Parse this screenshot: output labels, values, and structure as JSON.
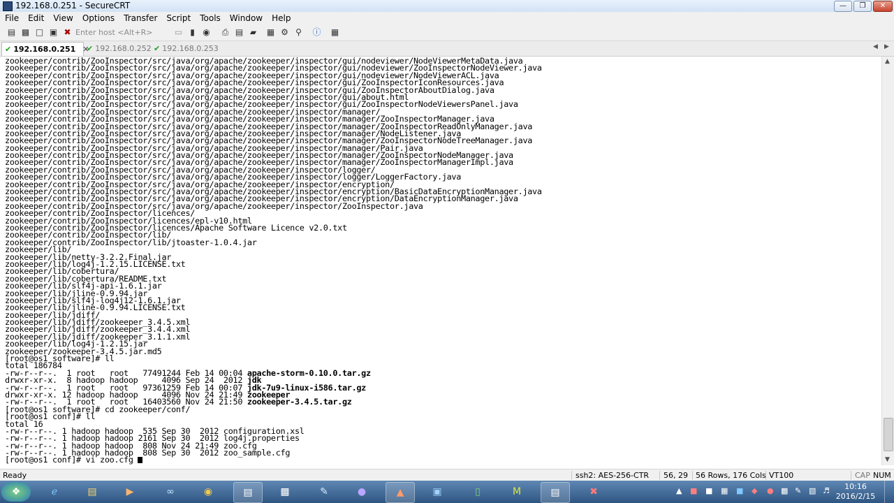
{
  "window": {
    "title": "192.168.0.251 - SecureCRT"
  },
  "menu": [
    "File",
    "Edit",
    "View",
    "Options",
    "Transfer",
    "Script",
    "Tools",
    "Window",
    "Help"
  ],
  "toolbar": {
    "host_placeholder": "Enter host <Alt+R>"
  },
  "tabs": [
    {
      "label": "192.168.0.251",
      "active": true
    },
    {
      "label": "192.168.0.252",
      "active": false
    },
    {
      "label": "192.168.0.253",
      "active": false
    }
  ],
  "terminal": {
    "lines": [
      "zookeeper/contrib/ZooInspector/src/java/org/apache/zookeeper/inspector/gui/nodeviewer/NodeViewerMetaData.java",
      "zookeeper/contrib/ZooInspector/src/java/org/apache/zookeeper/inspector/gui/nodeviewer/ZooInspectorNodeViewer.java",
      "zookeeper/contrib/ZooInspector/src/java/org/apache/zookeeper/inspector/gui/nodeviewer/NodeViewerACL.java",
      "zookeeper/contrib/ZooInspector/src/java/org/apache/zookeeper/inspector/gui/ZooInspectorIconResources.java",
      "zookeeper/contrib/ZooInspector/src/java/org/apache/zookeeper/inspector/gui/ZooInspectorAboutDialog.java",
      "zookeeper/contrib/ZooInspector/src/java/org/apache/zookeeper/inspector/gui/about.html",
      "zookeeper/contrib/ZooInspector/src/java/org/apache/zookeeper/inspector/gui/ZooInspectorNodeViewersPanel.java",
      "zookeeper/contrib/ZooInspector/src/java/org/apache/zookeeper/inspector/manager/",
      "zookeeper/contrib/ZooInspector/src/java/org/apache/zookeeper/inspector/manager/ZooInspectorManager.java",
      "zookeeper/contrib/ZooInspector/src/java/org/apache/zookeeper/inspector/manager/ZooInspectorReadOnlyManager.java",
      "zookeeper/contrib/ZooInspector/src/java/org/apache/zookeeper/inspector/manager/NodeListener.java",
      "zookeeper/contrib/ZooInspector/src/java/org/apache/zookeeper/inspector/manager/ZooInspectorNodeTreeManager.java",
      "zookeeper/contrib/ZooInspector/src/java/org/apache/zookeeper/inspector/manager/Pair.java",
      "zookeeper/contrib/ZooInspector/src/java/org/apache/zookeeper/inspector/manager/ZooInspectorNodeManager.java",
      "zookeeper/contrib/ZooInspector/src/java/org/apache/zookeeper/inspector/manager/ZooInspectorManagerImpl.java",
      "zookeeper/contrib/ZooInspector/src/java/org/apache/zookeeper/inspector/logger/",
      "zookeeper/contrib/ZooInspector/src/java/org/apache/zookeeper/inspector/logger/LoggerFactory.java",
      "zookeeper/contrib/ZooInspector/src/java/org/apache/zookeeper/inspector/encryption/",
      "zookeeper/contrib/ZooInspector/src/java/org/apache/zookeeper/inspector/encryption/BasicDataEncryptionManager.java",
      "zookeeper/contrib/ZooInspector/src/java/org/apache/zookeeper/inspector/encryption/DataEncryptionManager.java",
      "zookeeper/contrib/ZooInspector/src/java/org/apache/zookeeper/inspector/ZooInspector.java",
      "zookeeper/contrib/ZooInspector/licences/",
      "zookeeper/contrib/ZooInspector/licences/epl-v10.html",
      "zookeeper/contrib/ZooInspector/licences/Apache Software Licence v2.0.txt",
      "zookeeper/contrib/ZooInspector/lib/",
      "zookeeper/contrib/ZooInspector/lib/jtoaster-1.0.4.jar",
      "zookeeper/lib/",
      "zookeeper/lib/netty-3.2.2.Final.jar",
      "zookeeper/lib/log4j-1.2.15.LICENSE.txt",
      "zookeeper/lib/cobertura/",
      "zookeeper/lib/cobertura/README.txt",
      "zookeeper/lib/slf4j-api-1.6.1.jar",
      "zookeeper/lib/jline-0.9.94.jar",
      "zookeeper/lib/slf4j-log4j12-1.6.1.jar",
      "zookeeper/lib/jline-0.9.94.LICENSE.txt",
      "zookeeper/lib/jdiff/",
      "zookeeper/lib/jdiff/zookeeper_3.4.5.xml",
      "zookeeper/lib/jdiff/zookeeper_3.4.4.xml",
      "zookeeper/lib/jdiff/zookeeper_3.1.1.xml",
      "zookeeper/lib/log4j-1.2.15.jar",
      "zookeeper/zookeeper-3.4.5.jar.md5",
      "[root@os1 software]# ll",
      "total 186784",
      {
        "t": "-rw-r--r--.  1 root   root   77491244 Feb 14 00:04 ",
        "b": "apache-storm-0.10.0.tar.gz"
      },
      {
        "t": "drwxr-xr-x.  8 hadoop hadoop     4096 Sep 24  2012 ",
        "b": "jdk"
      },
      {
        "t": "-rw-r--r--.  1 root   root   97361259 Feb 14 00:07 ",
        "b": "jdk-7u9-linux-i586.tar.gz"
      },
      {
        "t": "drwxr-xr-x. 12 hadoop hadoop     4096 Nov 24 21:49 ",
        "b": "zookeeper"
      },
      {
        "t": "-rw-r--r--.  1 root   root   16403560 Nov 24 21:50 ",
        "b": "zookeeper-3.4.5.tar.gz"
      },
      "[root@os1 software]# cd zookeeper/conf/",
      "[root@os1 conf]# ll",
      "total 16",
      "-rw-r--r--. 1 hadoop hadoop  535 Sep 30  2012 configuration.xsl",
      "-rw-r--r--. 1 hadoop hadoop 2161 Sep 30  2012 log4j.properties",
      "-rw-r--r--. 1 hadoop hadoop  808 Nov 24 21:49 zoo.cfg",
      "-rw-r--r--. 1 hadoop hadoop  808 Sep 30  2012 zoo_sample.cfg",
      {
        "t": "[root@os1 conf]# vi zoo.cfg ",
        "cursor": true
      }
    ]
  },
  "status": {
    "left": "Ready",
    "cipher": "ssh2: AES-256-CTR",
    "position": "56, 29",
    "size": "56 Rows, 176 Cols",
    "emulation": "VT100",
    "caps": "CAP",
    "num": "NUM"
  },
  "taskbar": {
    "time": "10:16",
    "date": "2016/2/15"
  }
}
